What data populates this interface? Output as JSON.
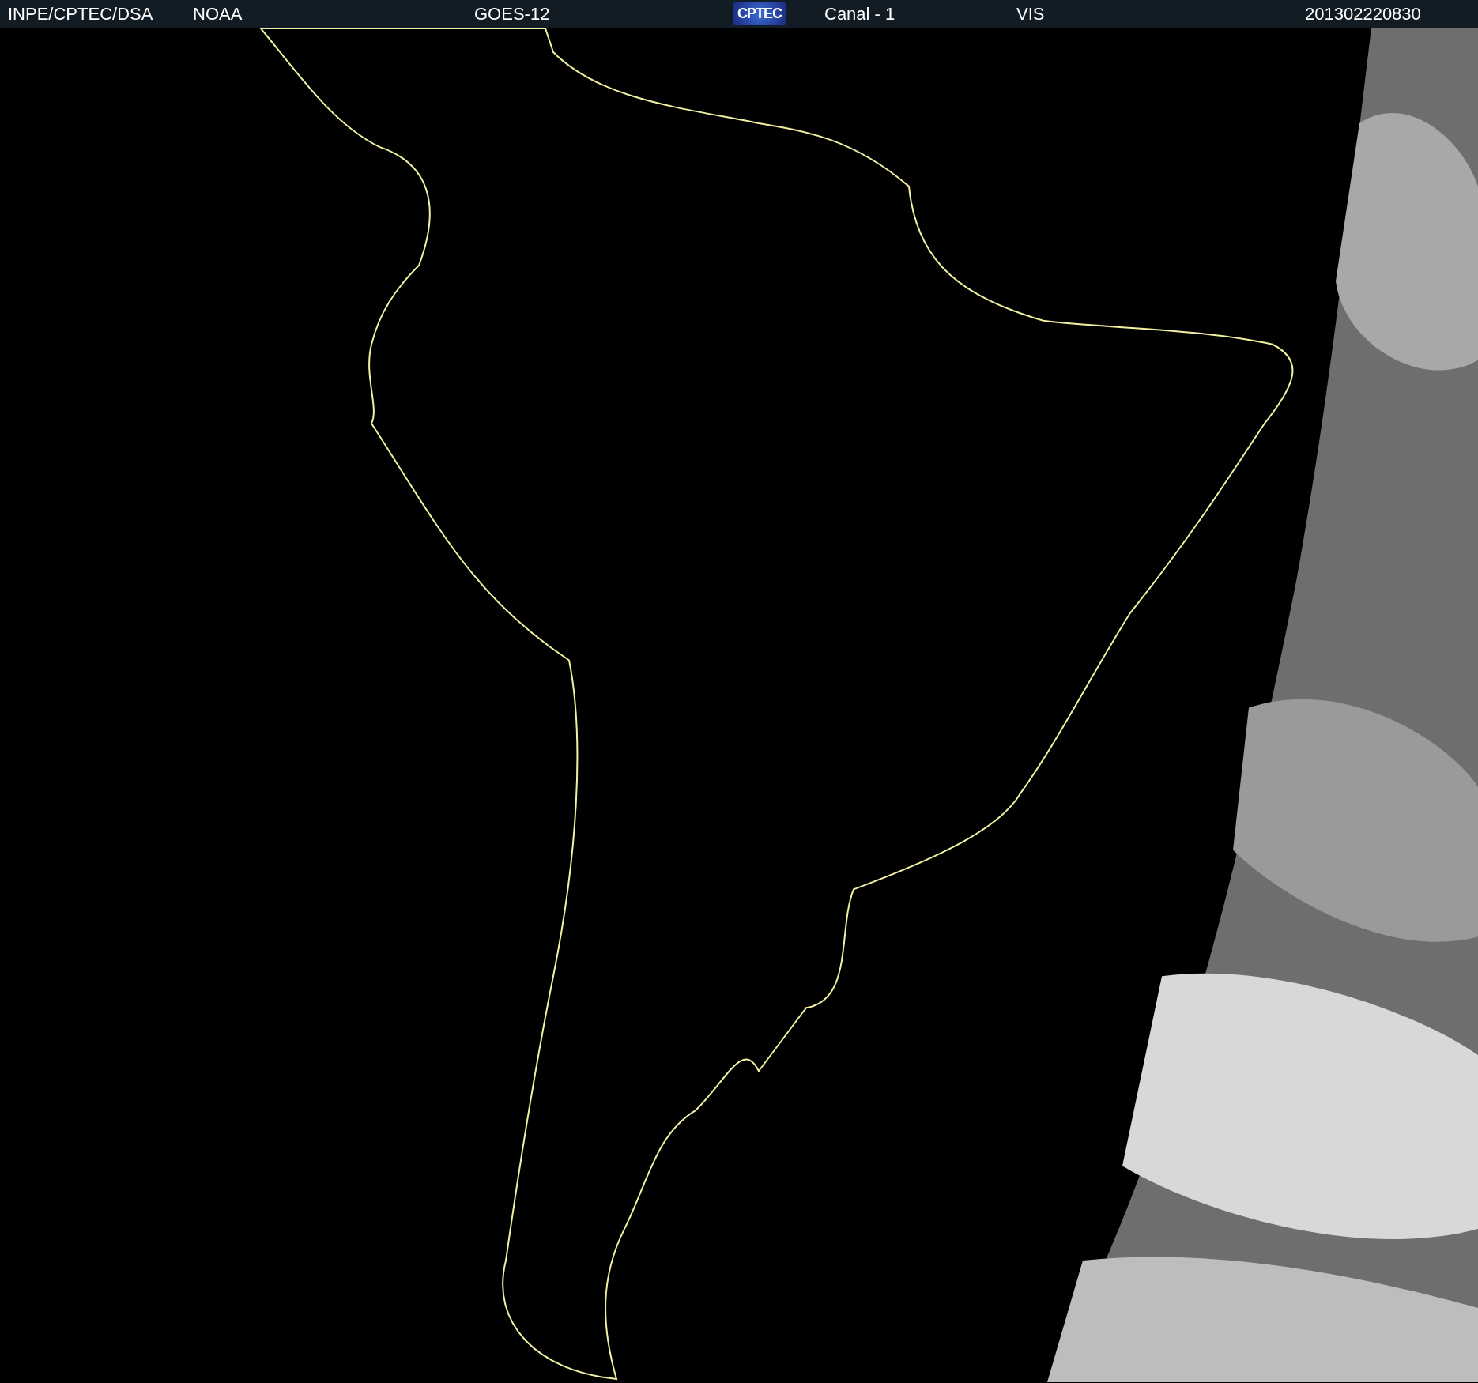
{
  "header": {
    "items": [
      {
        "kind": "text",
        "text": "INPE/CPTEC/DSA"
      },
      {
        "kind": "text",
        "text": "NOAA"
      },
      {
        "kind": "text",
        "text": "GOES-12"
      },
      {
        "kind": "logo",
        "text": "CPTEC"
      },
      {
        "kind": "text",
        "text": "Canal - 1"
      },
      {
        "kind": "text",
        "text": "VIS"
      },
      {
        "kind": "text",
        "text": "201302220830"
      }
    ]
  }
}
